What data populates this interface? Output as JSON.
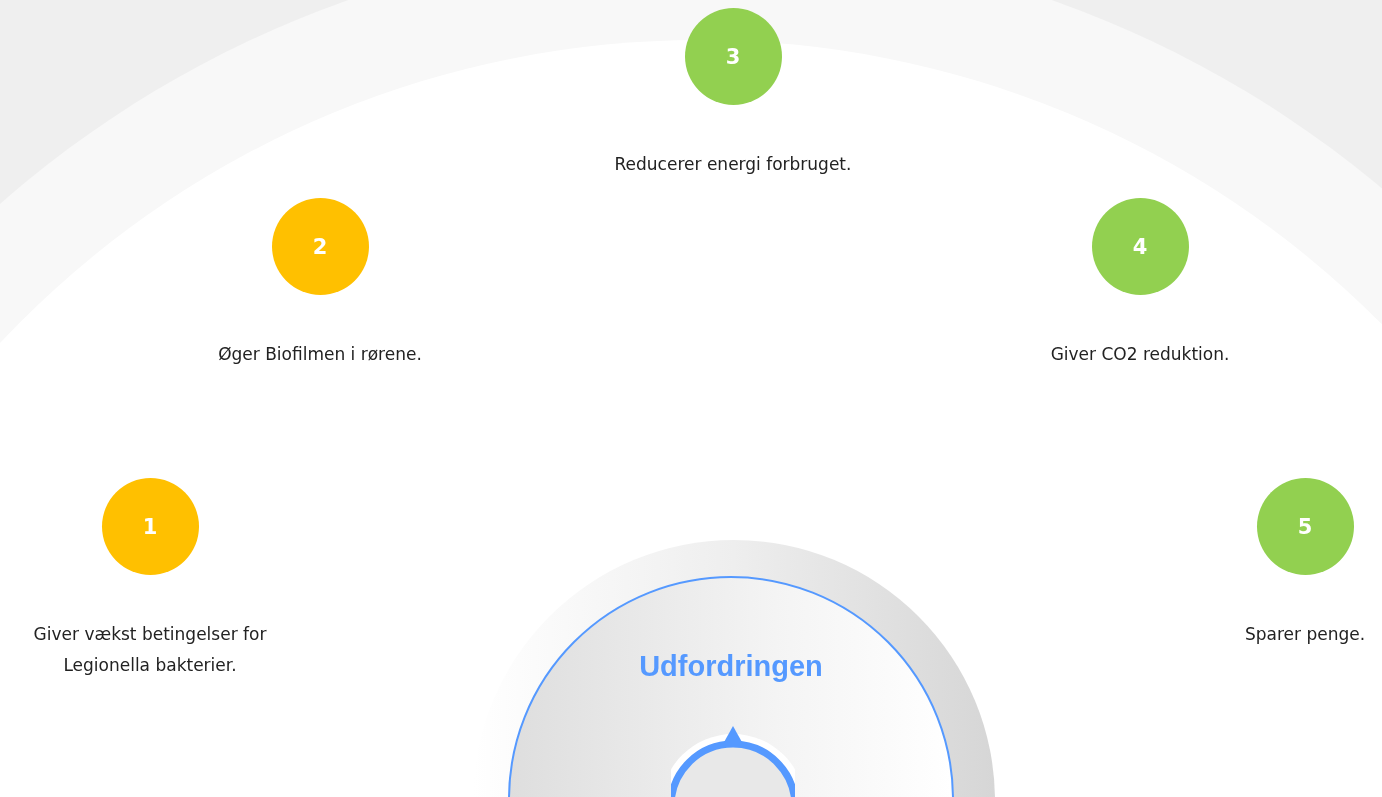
{
  "steps": [
    {
      "number": "1",
      "text": "Giver vækst betingelser for Legionella bakterier.",
      "color": "#ffc000"
    },
    {
      "number": "2",
      "text": "Øger Biofilmen i rørene.",
      "color": "#ffc000"
    },
    {
      "number": "3",
      "text": "Reducerer energi forbruget.",
      "color": "#92d050"
    },
    {
      "number": "4",
      "text": "Giver CO2 reduktion.",
      "color": "#92d050"
    },
    {
      "number": "5",
      "text": "Sparer penge.",
      "color": "#92d050"
    }
  ],
  "center": {
    "title": "Udfordringen"
  }
}
